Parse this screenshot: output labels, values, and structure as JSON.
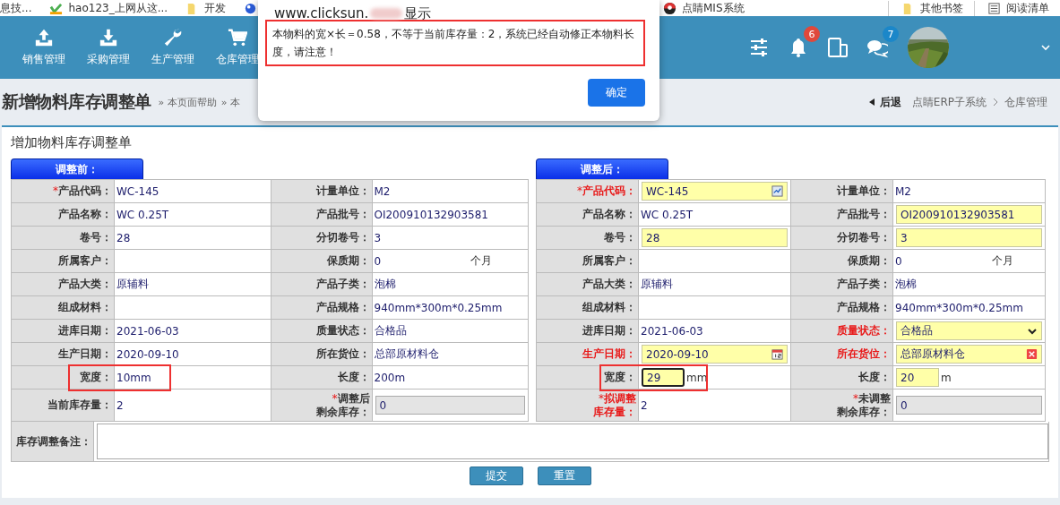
{
  "bookmarks": [
    {
      "label": "息技...",
      "kind": "none"
    },
    {
      "label": "hao123_上网从这...",
      "kind": "hao"
    },
    {
      "label": "开发",
      "kind": "folder"
    },
    {
      "kind": "globe"
    }
  ],
  "bookmarks_mid": [
    {
      "label": "点睛MIS系统",
      "kind": "mis"
    }
  ],
  "bookmarks_right": [
    {
      "label": "其他书签",
      "kind": "folder"
    },
    {
      "label": "阅读清单",
      "kind": "list"
    }
  ],
  "nav": [
    {
      "label": "销售管理",
      "kind": "upload"
    },
    {
      "label": "采购管理",
      "kind": "download"
    },
    {
      "label": "生产管理",
      "kind": "wrench"
    },
    {
      "label": "仓库管理",
      "kind": "cart"
    }
  ],
  "header_icons": [
    {
      "kind": "sliders"
    },
    {
      "kind": "bell",
      "badge": "6",
      "color": "#e0483b"
    },
    {
      "kind": "tablet"
    },
    {
      "kind": "chat",
      "badge": "7",
      "color": "#1b87c9"
    }
  ],
  "page": {
    "title": "新增物料库存调整单",
    "help_links": [
      "» 本页面帮助",
      "» 本"
    ],
    "back": "后退",
    "breadcrumb": [
      "点睛ERP子系统",
      "仓库管理"
    ]
  },
  "form": {
    "title": "增加物料库存调整单",
    "sections": [
      {
        "tab": "调整前：",
        "rows": [
          [
            {
              "label": "产品代码：",
              "mark": "*",
              "alert": false,
              "annotated": false,
              "kind": "text",
              "value": "WC-145"
            },
            {
              "label": "计量单位：",
              "alert": false,
              "annotated": false,
              "kind": "text",
              "value": "M2"
            }
          ],
          [
            {
              "label": "产品名称：",
              "alert": false,
              "annotated": false,
              "kind": "text",
              "value": "WC 0.25T"
            },
            {
              "label": "产品批号：",
              "alert": false,
              "annotated": false,
              "kind": "text",
              "value": "OI200910132903581"
            }
          ],
          [
            {
              "label": "卷号：",
              "alert": false,
              "annotated": false,
              "kind": "text",
              "value": "28"
            },
            {
              "label": "分切卷号：",
              "alert": false,
              "annotated": false,
              "kind": "text",
              "value": "3"
            }
          ],
          [
            {
              "label": "所属客户：",
              "alert": false,
              "annotated": false,
              "kind": "text"
            },
            {
              "label": "保质期：",
              "alert": false,
              "annotated": false,
              "kind": "text",
              "value": "0",
              "unit": "个月"
            }
          ],
          [
            {
              "label": "产品大类：",
              "alert": false,
              "annotated": false,
              "kind": "text",
              "value": "原辅料"
            },
            {
              "label": "产品子类：",
              "alert": false,
              "annotated": false,
              "kind": "text",
              "value": "泡棉"
            }
          ],
          [
            {
              "label": "组成材料：",
              "alert": false,
              "annotated": false,
              "kind": "text"
            },
            {
              "label": "产品规格：",
              "alert": false,
              "annotated": false,
              "kind": "text",
              "value": "940mm*300m*0.25mm"
            }
          ],
          [
            {
              "label": "进库日期：",
              "alert": false,
              "annotated": false,
              "kind": "text",
              "value": "2021-06-03"
            },
            {
              "label": "质量状态：",
              "alert": false,
              "annotated": false,
              "kind": "text",
              "value": "合格品"
            }
          ],
          [
            {
              "label": "生产日期：",
              "alert": false,
              "annotated": false,
              "kind": "text",
              "value": "2020-09-10"
            },
            {
              "label": "所在货位：",
              "alert": false,
              "annotated": false,
              "kind": "text",
              "value": "总部原材料仓"
            }
          ],
          [
            {
              "label": "宽度：",
              "alert": false,
              "annotated": true,
              "kind": "text",
              "value": "10mm"
            },
            {
              "label": "长度：",
              "alert": false,
              "annotated": false,
              "kind": "text",
              "value": "200m"
            }
          ],
          [
            {
              "label": "当前库存量：",
              "alert": false,
              "annotated": false,
              "kind": "text",
              "value": "2"
            },
            {
              "label_lines": [
                "调整后",
                "剩余库存："
              ],
              "mark": "*",
              "alert": false,
              "annotated": false,
              "kind": "readonly",
              "value": "0"
            }
          ]
        ]
      },
      {
        "tab": "调整后：",
        "rows": [
          [
            {
              "label": "产品代码：",
              "mark": "*",
              "alert": true,
              "annotated": false,
              "kind": "lookup",
              "value": "WC-145"
            },
            {
              "label": "计量单位：",
              "alert": false,
              "annotated": false,
              "kind": "text",
              "value": "M2"
            }
          ],
          [
            {
              "label": "产品名称：",
              "alert": false,
              "annotated": false,
              "kind": "text",
              "value": "WC 0.25T"
            },
            {
              "label": "产品批号：",
              "alert": false,
              "annotated": false,
              "kind": "input",
              "value": "OI200910132903581"
            }
          ],
          [
            {
              "label": "卷号：",
              "alert": false,
              "annotated": false,
              "kind": "input",
              "value": "28"
            },
            {
              "label": "分切卷号：",
              "alert": false,
              "annotated": false,
              "kind": "input",
              "value": "3"
            }
          ],
          [
            {
              "label": "所属客户：",
              "alert": false,
              "annotated": false,
              "kind": "text"
            },
            {
              "label": "保质期：",
              "alert": false,
              "annotated": false,
              "kind": "text",
              "value": "0",
              "unit": "个月"
            }
          ],
          [
            {
              "label": "产品大类：",
              "alert": false,
              "annotated": false,
              "kind": "text",
              "value": "原辅料"
            },
            {
              "label": "产品子类：",
              "alert": false,
              "annotated": false,
              "kind": "text",
              "value": "泡棉"
            }
          ],
          [
            {
              "label": "组成材料：",
              "alert": false,
              "annotated": false,
              "kind": "text"
            },
            {
              "label": "产品规格：",
              "alert": false,
              "annotated": false,
              "kind": "text",
              "value": "940mm*300m*0.25mm"
            }
          ],
          [
            {
              "label": "进库日期：",
              "alert": false,
              "annotated": false,
              "kind": "text",
              "value": "2021-06-03"
            },
            {
              "label": "质量状态：",
              "alert": true,
              "annotated": false,
              "kind": "select",
              "value": "合格品"
            }
          ],
          [
            {
              "label": "生产日期：",
              "alert": true,
              "annotated": false,
              "kind": "date",
              "value": "2020-09-10"
            },
            {
              "label": "所在货位：",
              "alert": true,
              "annotated": false,
              "kind": "clearable",
              "value": "总部原材料仓"
            }
          ],
          [
            {
              "label": "宽度：",
              "alert": false,
              "annotated": true,
              "kind": "short",
              "focused": true,
              "value": "29",
              "unit": "mm"
            },
            {
              "label": "长度：",
              "alert": false,
              "annotated": false,
              "kind": "short",
              "focused": false,
              "value": "20",
              "unit": "m"
            }
          ],
          [
            {
              "label_lines": [
                "拟调整",
                "库存量："
              ],
              "mark": "*",
              "alert": true,
              "annotated": false,
              "kind": "text",
              "value": "2"
            },
            {
              "label_lines": [
                "未调整",
                "剩余库存："
              ],
              "mark": "*",
              "alert": false,
              "annotated": false,
              "kind": "readonly",
              "value": "0"
            }
          ]
        ]
      }
    ],
    "remarks_label": "库存调整备注：",
    "buttons": [
      "提交",
      "重置"
    ]
  },
  "dialog": {
    "origin": "www.clicksun.",
    "suffix": "显示",
    "message": "本物料的宽×长＝0.58，不等于当前库存量：2，系统已经自动修正本物料长度，请注意！",
    "annotated": true,
    "button": "确定"
  }
}
